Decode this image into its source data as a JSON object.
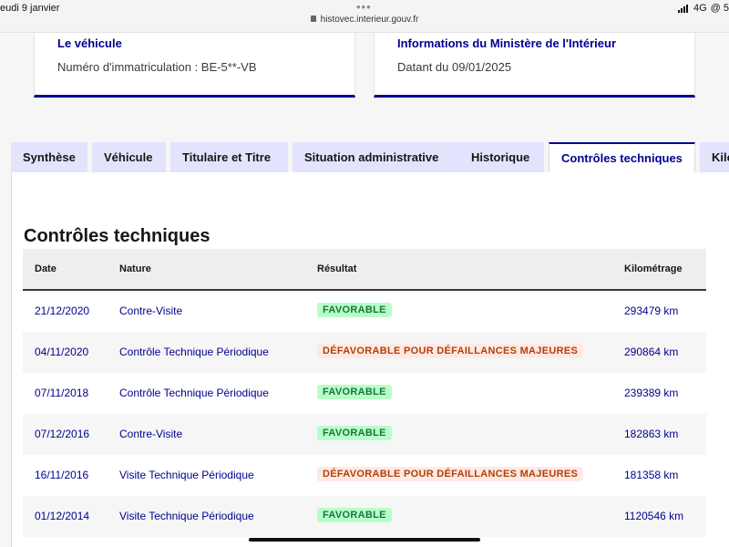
{
  "status_bar": {
    "date": "eudi 9 janvier",
    "url": "histovec.interieur.gouv.fr",
    "network": "4G",
    "right_extra": "@ 5"
  },
  "cards": [
    {
      "title": "Le véhicule",
      "text": "Numéro d'immatriculation : BE-5**-VB"
    },
    {
      "title": "Informations du Ministère de l'Intérieur",
      "text": "Datant du 09/01/2025"
    }
  ],
  "tabs": [
    {
      "label": "Synthèse",
      "active": false
    },
    {
      "label": "Véhicule",
      "active": false
    },
    {
      "label": "Titulaire et Titre",
      "active": false
    },
    {
      "label": "Situation administrative",
      "active": false
    },
    {
      "label": "Historique",
      "active": false
    },
    {
      "label": "Contrôles techniques",
      "active": true
    },
    {
      "label": "Kilo",
      "active": false
    }
  ],
  "section_title": "Contrôles techniques",
  "table": {
    "headers": {
      "date": "Date",
      "nature": "Nature",
      "result": "Résultat",
      "km": "Kilométrage"
    },
    "rows": [
      {
        "date": "21/12/2020",
        "nature": "Contre-Visite",
        "result": "FAVORABLE",
        "status": "ok",
        "km": "293479 km"
      },
      {
        "date": "04/11/2020",
        "nature": "Contrôle Technique Périodique",
        "result": "DÉFAVORABLE POUR DÉFAILLANCES MAJEURES",
        "status": "ko",
        "km": "290864 km"
      },
      {
        "date": "07/11/2018",
        "nature": "Contrôle Technique Périodique",
        "result": "FAVORABLE",
        "status": "ok",
        "km": "239389 km"
      },
      {
        "date": "07/12/2016",
        "nature": "Contre-Visite",
        "result": "FAVORABLE",
        "status": "ok",
        "km": "182863 km"
      },
      {
        "date": "16/11/2016",
        "nature": "Visite Technique Périodique",
        "result": "DÉFAVORABLE POUR DÉFAILLANCES MAJEURES",
        "status": "ko",
        "km": "181358 km"
      },
      {
        "date": "01/12/2014",
        "nature": "Visite Technique Périodique",
        "result": "FAVORABLE",
        "status": "ok",
        "km": "1120546 km"
      }
    ]
  },
  "colors": {
    "brand_blue": "#000091",
    "tab_bg": "#e3e3fd",
    "success_bg": "#b8fec9",
    "success_text": "#18753c",
    "error_bg": "#ffe9e6",
    "error_text": "#b34000"
  }
}
